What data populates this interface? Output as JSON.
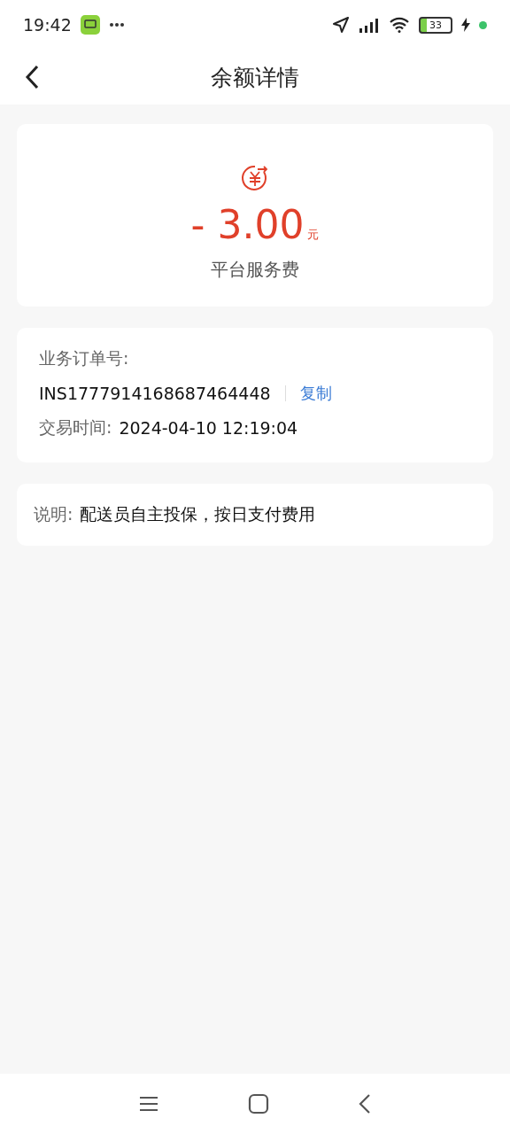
{
  "status_bar": {
    "time": "19:42",
    "battery": "33"
  },
  "header": {
    "title": "余额详情"
  },
  "summary": {
    "sign": "-",
    "amount": "3.00",
    "unit": "元",
    "description": "平台服务费"
  },
  "order": {
    "label": "业务订单号:",
    "number": "INS1777914168687464448",
    "copy": "复制",
    "time_label": "交易时间:",
    "time": "2024-04-10 12:19:04"
  },
  "note": {
    "label": "说明:",
    "text": "配送员自主投保，按日支付费用"
  }
}
